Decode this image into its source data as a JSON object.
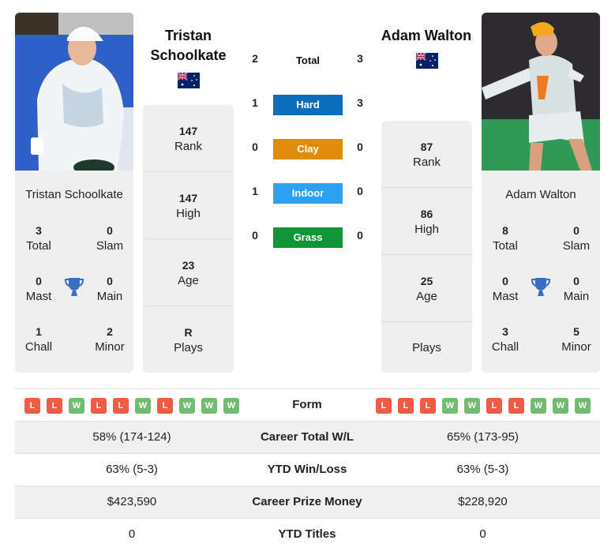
{
  "player1": {
    "name_title_line1": "Tristan",
    "name_title_line2": "Schoolkate",
    "card_name": "Tristan Schoolkate",
    "country_flag": "australia-flag",
    "titles": {
      "total": {
        "value": "3",
        "label": "Total"
      },
      "slam": {
        "value": "0",
        "label": "Slam"
      },
      "mast": {
        "value": "0",
        "label": "Mast"
      },
      "main": {
        "value": "0",
        "label": "Main"
      },
      "chall": {
        "value": "1",
        "label": "Chall"
      },
      "minor": {
        "value": "2",
        "label": "Minor"
      }
    },
    "stats": {
      "rank": {
        "value": "147",
        "label": "Rank"
      },
      "high": {
        "value": "147",
        "label": "High"
      },
      "age": {
        "value": "23",
        "label": "Age"
      },
      "plays": {
        "value": "R",
        "label": "Plays"
      }
    },
    "form": [
      "L",
      "L",
      "W",
      "L",
      "L",
      "W",
      "L",
      "W",
      "W",
      "W"
    ]
  },
  "player2": {
    "name_title": "Adam Walton",
    "card_name": "Adam Walton",
    "country_flag": "australia-flag",
    "titles": {
      "total": {
        "value": "8",
        "label": "Total"
      },
      "slam": {
        "value": "0",
        "label": "Slam"
      },
      "mast": {
        "value": "0",
        "label": "Mast"
      },
      "main": {
        "value": "0",
        "label": "Main"
      },
      "chall": {
        "value": "3",
        "label": "Chall"
      },
      "minor": {
        "value": "5",
        "label": "Minor"
      }
    },
    "stats": {
      "rank": {
        "value": "87",
        "label": "Rank"
      },
      "high": {
        "value": "86",
        "label": "High"
      },
      "age": {
        "value": "25",
        "label": "Age"
      },
      "plays": {
        "value": "",
        "label": "Plays"
      }
    },
    "form": [
      "L",
      "L",
      "L",
      "W",
      "W",
      "L",
      "L",
      "W",
      "W",
      "W"
    ]
  },
  "h2h": {
    "total": {
      "label": "Total",
      "p1": "2",
      "p2": "3"
    },
    "surfaces": [
      {
        "label": "Hard",
        "p1": "1",
        "p2": "3",
        "color": "#0a6ebd"
      },
      {
        "label": "Clay",
        "p1": "0",
        "p2": "0",
        "color": "#e08c0a"
      },
      {
        "label": "Indoor",
        "p1": "1",
        "p2": "0",
        "color": "#2ea0f0"
      },
      {
        "label": "Grass",
        "p1": "0",
        "p2": "0",
        "color": "#0f9438"
      }
    ]
  },
  "comparison": {
    "form_label": "Form",
    "rows": [
      {
        "label": "Career Total W/L",
        "p1": "58% (174-124)",
        "p2": "65% (173-95)"
      },
      {
        "label": "YTD Win/Loss",
        "p1": "63% (5-3)",
        "p2": "63% (5-3)"
      },
      {
        "label": "Career Prize Money",
        "p1": "$423,590",
        "p2": "$228,920"
      },
      {
        "label": "YTD Titles",
        "p1": "0",
        "p2": "0"
      }
    ]
  },
  "colors": {
    "loss": "#ef5b45",
    "win": "#72bb72",
    "trophy": "#3a6fc0"
  }
}
